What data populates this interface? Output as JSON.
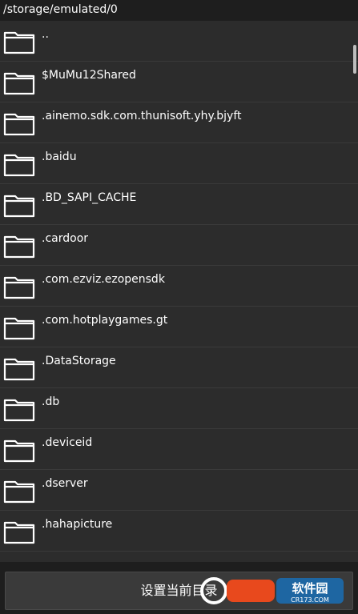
{
  "path": "/storage/emulated/0",
  "items": [
    {
      "label": ".."
    },
    {
      "label": "$MuMu12Shared"
    },
    {
      "label": ".ainemo.sdk.com.thunisoft.yhy.bjyft"
    },
    {
      "label": ".baidu"
    },
    {
      "label": ".BD_SAPI_CACHE"
    },
    {
      "label": ".cardoor"
    },
    {
      "label": ".com.ezviz.ezopensdk"
    },
    {
      "label": ".com.hotplaygames.gt"
    },
    {
      "label": ".DataStorage"
    },
    {
      "label": ".db"
    },
    {
      "label": ".deviceid"
    },
    {
      "label": ".dserver"
    },
    {
      "label": ".hahapicture"
    },
    {
      "label": ""
    }
  ],
  "button": {
    "label": "设置当前目录"
  },
  "watermark": {
    "text": "软件园",
    "subtext": "CR173.COM"
  },
  "colors": {
    "background": "#1e1e1e",
    "list_bg": "#2c2c2c",
    "text": "#ffffff",
    "folder_stroke": "#ffffff"
  }
}
